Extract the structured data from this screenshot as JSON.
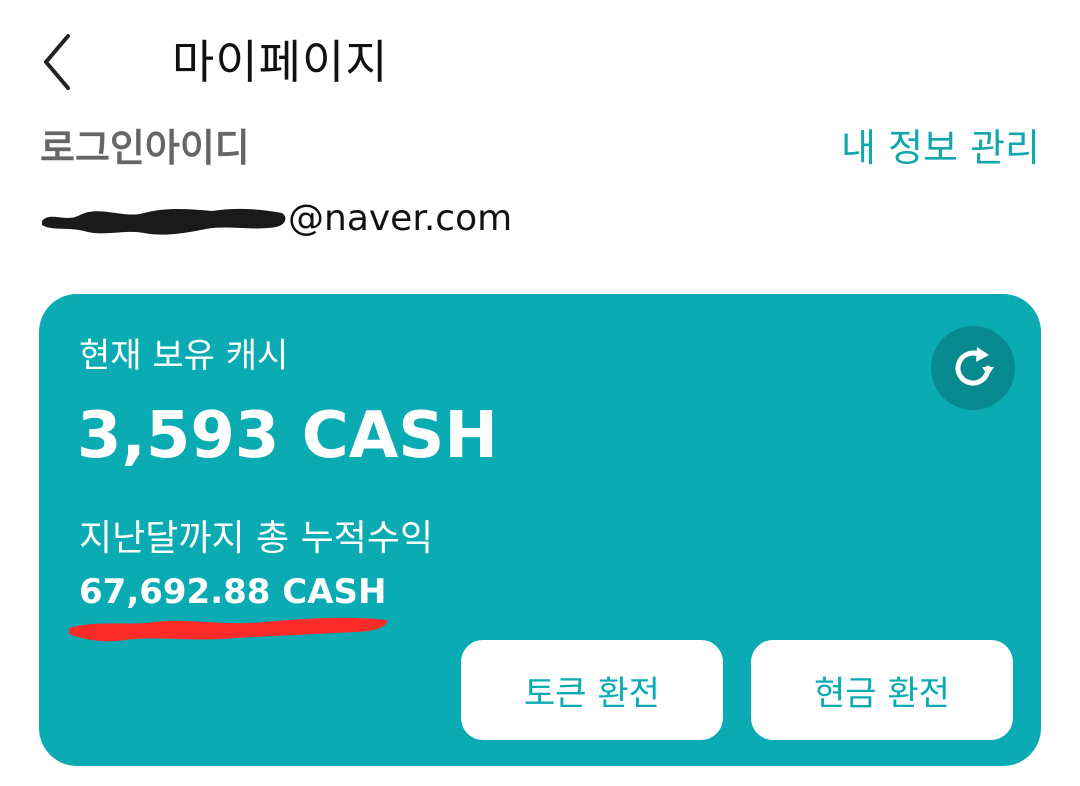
{
  "header": {
    "title": "마이페이지",
    "back_icon": "chevron-left-icon"
  },
  "account": {
    "label": "로그인아이디",
    "manage_link": "내 정보 관리",
    "email_visible": "@naver.com"
  },
  "cash_card": {
    "balance_label": "현재 보유 캐시",
    "balance_amount": "3,593 CASH",
    "total_label": "지난달까지 총 누적수익",
    "total_amount": "67,692.88 CASH",
    "refresh_icon": "refresh-icon",
    "buttons": {
      "token_exchange": "토큰 환전",
      "cash_exchange": "현금 환전"
    }
  },
  "colors": {
    "accent": "#0aabb3",
    "accent_dark": "#078a8f",
    "label_gray": "#666666",
    "highlight_red": "#ff2a2a"
  }
}
